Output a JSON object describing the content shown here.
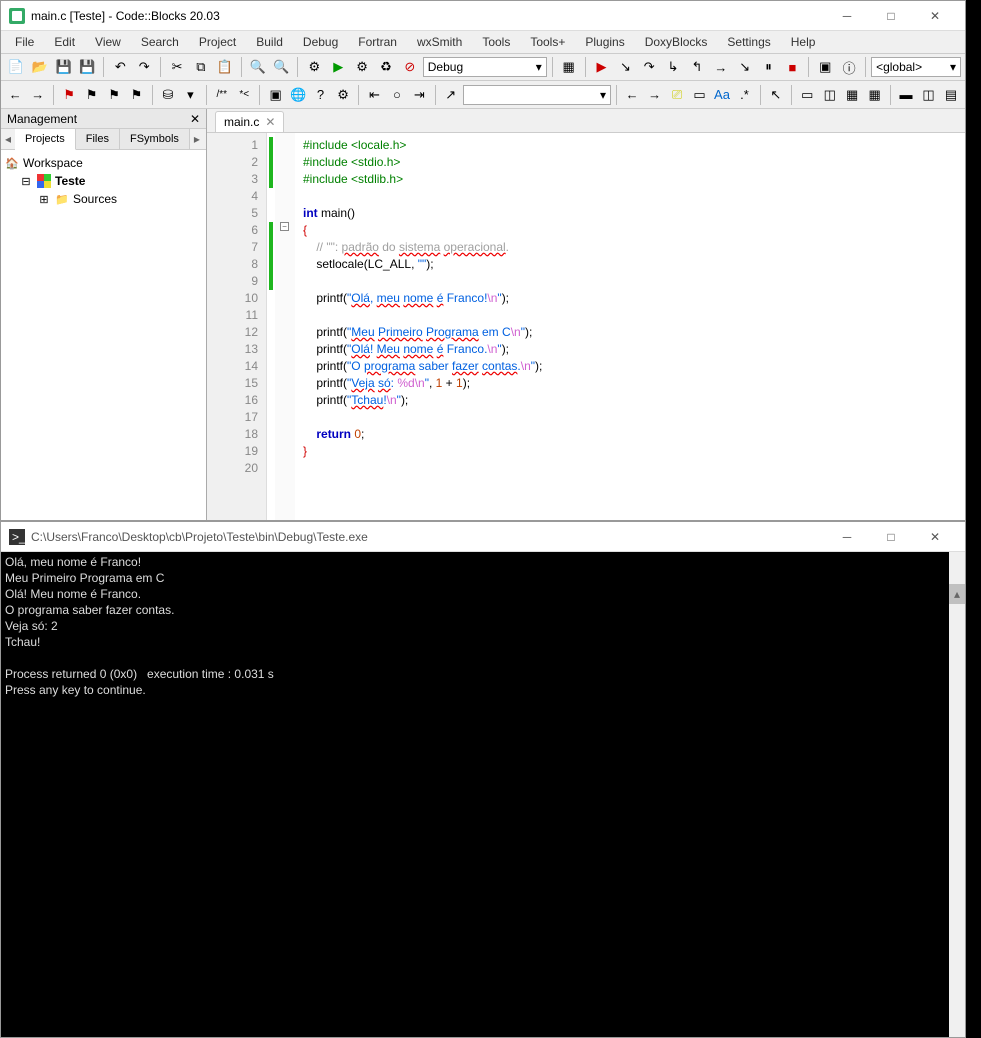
{
  "ide": {
    "title": "main.c [Teste] - Code::Blocks 20.03",
    "menus": [
      "File",
      "Edit",
      "View",
      "Search",
      "Project",
      "Build",
      "Debug",
      "Fortran",
      "wxSmith",
      "Tools",
      "Tools+",
      "Plugins",
      "DoxyBlocks",
      "Settings",
      "Help"
    ],
    "build_target": "Debug",
    "scope_combo": "<global>",
    "management": {
      "title": "Management",
      "tabs": [
        "Projects",
        "Files",
        "FSymbols"
      ],
      "active_tab": 0,
      "workspace": "Workspace",
      "project": "Teste",
      "folder": "Sources"
    },
    "editor": {
      "tab_label": "main.c",
      "lines": [
        {
          "n": 1,
          "changed": true,
          "tokens": [
            {
              "t": "#include ",
              "c": "kw-pre"
            },
            {
              "t": "<locale.h>",
              "c": "kw-pre"
            }
          ]
        },
        {
          "n": 2,
          "changed": true,
          "tokens": [
            {
              "t": "#include ",
              "c": "kw-pre"
            },
            {
              "t": "<stdio.h>",
              "c": "kw-pre"
            }
          ]
        },
        {
          "n": 3,
          "changed": true,
          "tokens": [
            {
              "t": "#include ",
              "c": "kw-pre"
            },
            {
              "t": "<stdlib.h>",
              "c": "kw-pre"
            }
          ]
        },
        {
          "n": 4,
          "changed": false,
          "tokens": []
        },
        {
          "n": 5,
          "changed": false,
          "tokens": [
            {
              "t": "int ",
              "c": "kw-blue"
            },
            {
              "t": "main",
              "c": ""
            },
            {
              "t": "()",
              "c": ""
            }
          ]
        },
        {
          "n": 6,
          "changed": true,
          "tokens": [
            {
              "t": "{",
              "c": "kw-brace"
            }
          ]
        },
        {
          "n": 7,
          "changed": true,
          "tokens": [
            {
              "t": "    ",
              "c": ""
            },
            {
              "t": "// \"\": ",
              "c": "kw-cmt"
            },
            {
              "t": "padrão",
              "c": "kw-cmt-wavy"
            },
            {
              "t": " do ",
              "c": "kw-cmt"
            },
            {
              "t": "sistema",
              "c": "kw-cmt-wavy"
            },
            {
              "t": " ",
              "c": "kw-cmt"
            },
            {
              "t": "operacional",
              "c": "kw-cmt-wavy"
            },
            {
              "t": ".",
              "c": "kw-cmt"
            }
          ]
        },
        {
          "n": 8,
          "changed": true,
          "tokens": [
            {
              "t": "    setlocale",
              "c": ""
            },
            {
              "t": "(",
              "c": ""
            },
            {
              "t": "LC_ALL",
              "c": ""
            },
            {
              "t": ", ",
              "c": ""
            },
            {
              "t": "\"\"",
              "c": "kw-str"
            },
            {
              "t": ");",
              "c": ""
            }
          ]
        },
        {
          "n": 9,
          "changed": true,
          "tokens": []
        },
        {
          "n": 10,
          "changed": false,
          "tokens": [
            {
              "t": "    printf",
              "c": ""
            },
            {
              "t": "(",
              "c": ""
            },
            {
              "t": "\"",
              "c": "kw-str"
            },
            {
              "t": "Olá",
              "c": "kw-str-wavy"
            },
            {
              "t": ", ",
              "c": "kw-str"
            },
            {
              "t": "meu",
              "c": "kw-str-wavy"
            },
            {
              "t": " ",
              "c": "kw-str"
            },
            {
              "t": "nome",
              "c": "kw-str-wavy"
            },
            {
              "t": " ",
              "c": "kw-str"
            },
            {
              "t": "é",
              "c": "kw-str-wavy"
            },
            {
              "t": " Franco!",
              "c": "kw-str"
            },
            {
              "t": "\\n",
              "c": "kw-esc"
            },
            {
              "t": "\"",
              "c": "kw-str"
            },
            {
              "t": ");",
              "c": ""
            }
          ]
        },
        {
          "n": 11,
          "changed": false,
          "tokens": []
        },
        {
          "n": 12,
          "changed": false,
          "tokens": [
            {
              "t": "    printf",
              "c": ""
            },
            {
              "t": "(",
              "c": ""
            },
            {
              "t": "\"",
              "c": "kw-str"
            },
            {
              "t": "Meu",
              "c": "kw-str-wavy"
            },
            {
              "t": " ",
              "c": "kw-str"
            },
            {
              "t": "Primeiro",
              "c": "kw-str-wavy"
            },
            {
              "t": " ",
              "c": "kw-str"
            },
            {
              "t": "Programa",
              "c": "kw-str-wavy"
            },
            {
              "t": " em C",
              "c": "kw-str"
            },
            {
              "t": "\\n",
              "c": "kw-esc"
            },
            {
              "t": "\"",
              "c": "kw-str"
            },
            {
              "t": ");",
              "c": ""
            }
          ]
        },
        {
          "n": 13,
          "changed": false,
          "tokens": [
            {
              "t": "    printf",
              "c": ""
            },
            {
              "t": "(",
              "c": ""
            },
            {
              "t": "\"",
              "c": "kw-str"
            },
            {
              "t": "Olá",
              "c": "kw-str-wavy"
            },
            {
              "t": "! ",
              "c": "kw-str"
            },
            {
              "t": "Meu",
              "c": "kw-str-wavy"
            },
            {
              "t": " ",
              "c": "kw-str"
            },
            {
              "t": "nome",
              "c": "kw-str-wavy"
            },
            {
              "t": " ",
              "c": "kw-str"
            },
            {
              "t": "é",
              "c": "kw-str-wavy"
            },
            {
              "t": " Franco.",
              "c": "kw-str"
            },
            {
              "t": "\\n",
              "c": "kw-esc"
            },
            {
              "t": "\"",
              "c": "kw-str"
            },
            {
              "t": ");",
              "c": ""
            }
          ]
        },
        {
          "n": 14,
          "changed": false,
          "tokens": [
            {
              "t": "    printf",
              "c": ""
            },
            {
              "t": "(",
              "c": ""
            },
            {
              "t": "\"O ",
              "c": "kw-str"
            },
            {
              "t": "programa",
              "c": "kw-str-wavy"
            },
            {
              "t": " saber ",
              "c": "kw-str"
            },
            {
              "t": "fazer",
              "c": "kw-str-wavy"
            },
            {
              "t": " ",
              "c": "kw-str"
            },
            {
              "t": "contas",
              "c": "kw-str-wavy"
            },
            {
              "t": ".",
              "c": "kw-str"
            },
            {
              "t": "\\n",
              "c": "kw-esc"
            },
            {
              "t": "\"",
              "c": "kw-str"
            },
            {
              "t": ");",
              "c": ""
            }
          ]
        },
        {
          "n": 15,
          "changed": false,
          "tokens": [
            {
              "t": "    printf",
              "c": ""
            },
            {
              "t": "(",
              "c": ""
            },
            {
              "t": "\"",
              "c": "kw-str"
            },
            {
              "t": "Veja",
              "c": "kw-str-wavy"
            },
            {
              "t": " ",
              "c": "kw-str"
            },
            {
              "t": "só",
              "c": "kw-str-wavy"
            },
            {
              "t": ": ",
              "c": "kw-str"
            },
            {
              "t": "%d",
              "c": "kw-esc"
            },
            {
              "t": "\\n",
              "c": "kw-esc"
            },
            {
              "t": "\"",
              "c": "kw-str"
            },
            {
              "t": ", ",
              "c": ""
            },
            {
              "t": "1",
              "c": "kw-num"
            },
            {
              "t": " + ",
              "c": ""
            },
            {
              "t": "1",
              "c": "kw-num"
            },
            {
              "t": ");",
              "c": ""
            }
          ]
        },
        {
          "n": 16,
          "changed": false,
          "tokens": [
            {
              "t": "    printf",
              "c": ""
            },
            {
              "t": "(",
              "c": ""
            },
            {
              "t": "\"",
              "c": "kw-str"
            },
            {
              "t": "Tchau",
              "c": "kw-str-wavy"
            },
            {
              "t": "!",
              "c": "kw-str"
            },
            {
              "t": "\\n",
              "c": "kw-esc"
            },
            {
              "t": "\"",
              "c": "kw-str"
            },
            {
              "t": ");",
              "c": ""
            }
          ]
        },
        {
          "n": 17,
          "changed": false,
          "tokens": []
        },
        {
          "n": 18,
          "changed": false,
          "tokens": [
            {
              "t": "    ",
              "c": ""
            },
            {
              "t": "return ",
              "c": "kw-blue"
            },
            {
              "t": "0",
              "c": "kw-num"
            },
            {
              "t": ";",
              "c": ""
            }
          ]
        },
        {
          "n": 19,
          "changed": false,
          "tokens": [
            {
              "t": "}",
              "c": "kw-brace"
            }
          ]
        },
        {
          "n": 20,
          "changed": false,
          "tokens": []
        }
      ]
    }
  },
  "console": {
    "title": "C:\\Users\\Franco\\Desktop\\cb\\Projeto\\Teste\\bin\\Debug\\Teste.exe",
    "lines": [
      "Olá, meu nome é Franco!",
      "Meu Primeiro Programa em C",
      "Olá! Meu nome é Franco.",
      "O programa saber fazer contas.",
      "Veja só: 2",
      "Tchau!",
      "",
      "Process returned 0 (0x0)   execution time : 0.031 s",
      "Press any key to continue."
    ]
  }
}
